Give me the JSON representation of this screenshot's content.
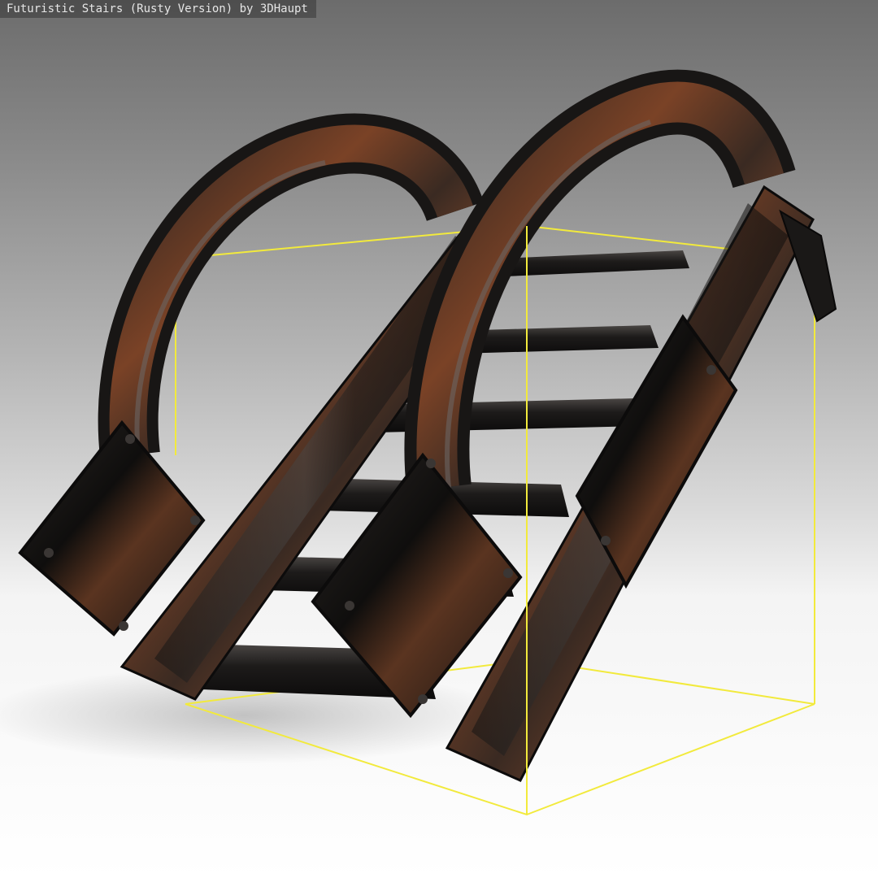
{
  "window": {
    "title": "Futuristic Stairs (Rusty Version) by 3DHaupt"
  },
  "viewport": {
    "background_top": "#6c6c6c",
    "background_bottom": "#ffffff",
    "bounding_box_color": "#f5ee3a"
  },
  "model": {
    "metal_color": "#1e1c1b",
    "rust_color": "#8a4a2a",
    "highlight_color": "#6a6a6a"
  }
}
